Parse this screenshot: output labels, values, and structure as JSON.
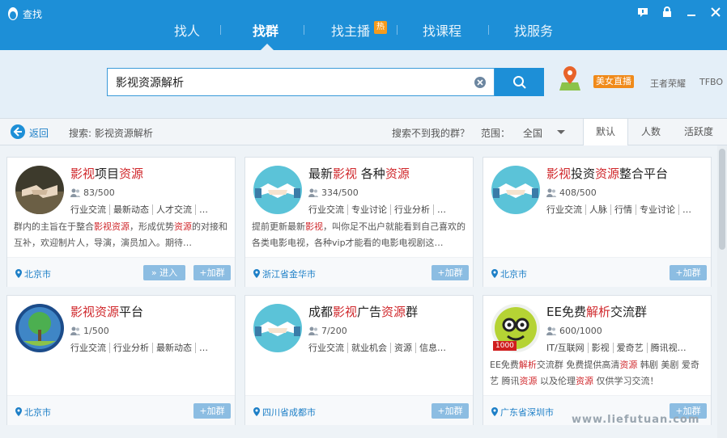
{
  "window": {
    "title": "查找"
  },
  "nav": {
    "tabs": [
      "找人",
      "找群",
      "找主播",
      "找课程",
      "找服务"
    ],
    "active": "找群",
    "hot_badge": "热"
  },
  "search": {
    "value": "影视资源解析",
    "placeholder": ""
  },
  "promo": {
    "live_badge": "美女直播",
    "link1": "王者荣耀",
    "link2": "TFBO"
  },
  "toolbar": {
    "back_label": "返回",
    "query_label": "搜索: 影视资源解析",
    "not_found": "搜索不到我的群？",
    "scope_label": "范围：",
    "scope_value": "全国",
    "sort_tabs": [
      "默认",
      "人数",
      "活跃度"
    ],
    "active_sort": "默认"
  },
  "cards": [
    {
      "name_parts": [
        {
          "t": "影视",
          "h": true
        },
        {
          "t": "项目",
          "h": false
        },
        {
          "t": "资源",
          "h": true
        }
      ],
      "members": "83/500",
      "tags": [
        "行业交流",
        "最新动态",
        "人才交流",
        "…"
      ],
      "desc_parts": [
        {
          "t": "群内的主旨在于整合",
          "h": false
        },
        {
          "t": "影视资源",
          "h": true
        },
        {
          "t": "，形成优势",
          "h": false
        },
        {
          "t": "资源",
          "h": true
        },
        {
          "t": "的对接和互补，欢迎制片人，导演，演员加入。期待…",
          "h": false
        }
      ],
      "location": "北京市",
      "enter_label": "» 进入",
      "join_label": "+加群",
      "avatar": "handshake-photo"
    },
    {
      "name_parts": [
        {
          "t": "最新",
          "h": false
        },
        {
          "t": "影视",
          "h": true
        },
        {
          "t": " 各种",
          "h": false
        },
        {
          "t": "资源",
          "h": true
        }
      ],
      "members": "334/500",
      "tags": [
        "行业交流",
        "专业讨论",
        "行业分析",
        "…"
      ],
      "desc_parts": [
        {
          "t": "提前更新最新",
          "h": false
        },
        {
          "t": "影视",
          "h": true
        },
        {
          "t": "，叫你足不出户就能看到自己喜欢的各类电影电视，各种vip才能看的电影电视剧这…",
          "h": false
        }
      ],
      "location": "浙江省金华市",
      "join_label": "+加群",
      "avatar": "handshake-default"
    },
    {
      "name_parts": [
        {
          "t": "影视",
          "h": true
        },
        {
          "t": "投资",
          "h": false
        },
        {
          "t": "资源",
          "h": true
        },
        {
          "t": "整合平台",
          "h": false
        }
      ],
      "members": "408/500",
      "tags": [
        "行业交流",
        "人脉",
        "行情",
        "专业讨论",
        "…"
      ],
      "desc_parts": [],
      "location": "北京市",
      "join_label": "+加群",
      "avatar": "handshake-default"
    },
    {
      "name_parts": [
        {
          "t": "影视",
          "h": true
        },
        {
          "t": "资源",
          "h": true
        },
        {
          "t": "平台",
          "h": false
        }
      ],
      "members": "1/500",
      "tags": [
        "行业交流",
        "行业分析",
        "最新动态",
        "…"
      ],
      "desc_parts": [],
      "location": "北京市",
      "join_label": "+加群",
      "avatar": "tree-globe"
    },
    {
      "name_parts": [
        {
          "t": "成都",
          "h": false
        },
        {
          "t": "影视",
          "h": true
        },
        {
          "t": "广告",
          "h": false
        },
        {
          "t": "资源",
          "h": true
        },
        {
          "t": "群",
          "h": false
        }
      ],
      "members": "7/200",
      "tags": [
        "行业交流",
        "就业机会",
        "资源",
        "信息…"
      ],
      "desc_parts": [],
      "location": "四川省成都市",
      "join_label": "+加群",
      "avatar": "handshake-default"
    },
    {
      "name_parts": [
        {
          "t": "EE免费",
          "h": false
        },
        {
          "t": "解析",
          "h": true
        },
        {
          "t": "交流群",
          "h": false
        }
      ],
      "members": "600/1000",
      "tags": [
        "IT/互联网",
        "影视",
        "爱奇艺",
        "腾讯视…"
      ],
      "desc_parts": [
        {
          "t": "EE免费",
          "h": false
        },
        {
          "t": "解析",
          "h": true
        },
        {
          "t": "交流群 免费提供高清",
          "h": false
        },
        {
          "t": "资源",
          "h": true
        },
        {
          "t": " 韩剧 美剧 爱奇艺 腾讯",
          "h": false
        },
        {
          "t": "资源",
          "h": true
        },
        {
          "t": " 以及伦理",
          "h": false
        },
        {
          "t": "资源",
          "h": true
        },
        {
          "t": " 仅供学习交流！",
          "h": false
        }
      ],
      "location": "广东省深圳市",
      "join_label": "+加群",
      "avatar": "cartoon-face",
      "avatar_badge": "1000"
    }
  ],
  "watermark": "www.liefutuan.com",
  "colors": {
    "primary": "#1d8fd7",
    "highlight": "#d0282c",
    "button": "#8cbde2",
    "badge": "#f08a1a"
  }
}
